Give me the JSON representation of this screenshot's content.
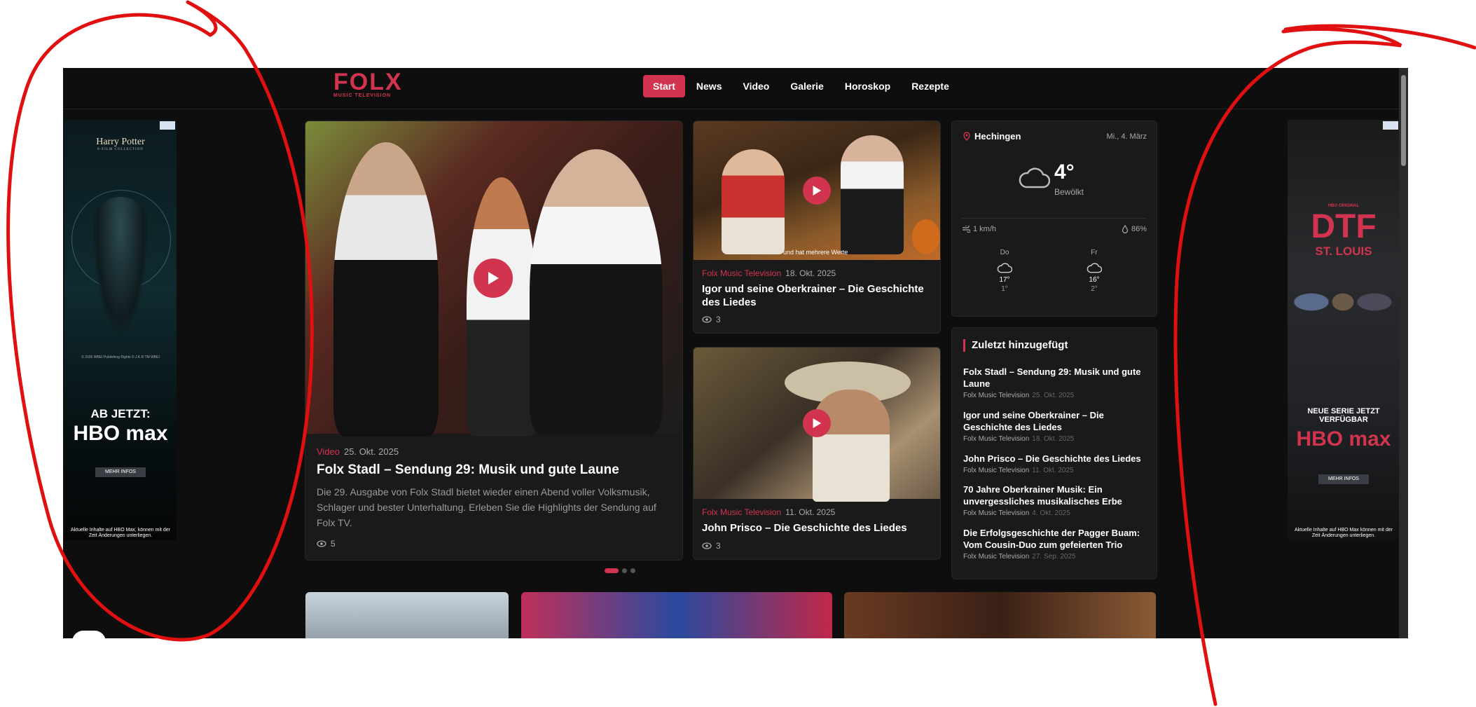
{
  "site": {
    "logo_text": "FOLX",
    "logo_subtitle": "MUSIC TELEVISION"
  },
  "nav": [
    {
      "label": "Start",
      "active": true
    },
    {
      "label": "News",
      "active": false
    },
    {
      "label": "Video",
      "active": false
    },
    {
      "label": "Galerie",
      "active": false
    },
    {
      "label": "Horoskop",
      "active": false
    },
    {
      "label": "Rezepte",
      "active": false
    }
  ],
  "ad_left": {
    "brand": "Harry Potter",
    "brand_sub": "8-FILM COLLECTION",
    "copyright": "© 2026 WBEI Publishing Rights © J.K.R TM WBEI",
    "cta": "AB JETZT:",
    "logo": "HBO max",
    "button": "MEHR INFOS",
    "fine_print": "Aktuelle Inhalte auf HBO Max, können mit der Zeit Änderungen unterliegen."
  },
  "ad_right": {
    "brand": "HBO ORIGINAL",
    "title": "DTF",
    "subtitle": "ST. LOUIS",
    "cta": "NEUE SERIE JETZT VERFÜGBAR",
    "logo": "HBO max",
    "button": "MEHR INFOS",
    "fine_print": "Aktuelle Inhalte auf HBO Max können mit der Zeit Änderungen unterliegen."
  },
  "hero": {
    "category": "Video",
    "date": "25. Okt. 2025",
    "title": "Folx Stadl – Sendung 29: Musik und gute Laune",
    "description": "Die 29. Ausgabe von Folx Stadl bietet wieder einen Abend voller Volksmusik, Schlager und bester Unterhaltung. Erleben Sie die Highlights der Sendung auf Folx TV.",
    "views": "5"
  },
  "cards": [
    {
      "category": "Folx Music Television",
      "date": "18. Okt. 2025",
      "title": "Igor und seine Oberkrainer – Die Geschichte des Liedes",
      "views": "3",
      "image_caption": "und hat mehrere Werte"
    },
    {
      "category": "Folx Music Television",
      "date": "11. Okt. 2025",
      "title": "John Prisco – Die Geschichte des Liedes",
      "views": "3"
    }
  ],
  "weather": {
    "city": "Hechingen",
    "date": "Mi., 4. März",
    "temp": "4°",
    "condition": "Bewölkt",
    "wind": "1 km/h",
    "humidity": "86%",
    "forecast": [
      {
        "day": "Do",
        "hi": "17°",
        "lo": "1°"
      },
      {
        "day": "Fr",
        "hi": "16°",
        "lo": "2°"
      }
    ]
  },
  "recent": {
    "heading": "Zuletzt hinzugefügt",
    "items": [
      {
        "title": "Folx Stadl – Sendung 29: Musik und gute Laune",
        "source": "Folx Music Television",
        "date": "25. Okt. 2025"
      },
      {
        "title": "Igor und seine Oberkrainer – Die Geschichte des Liedes",
        "source": "Folx Music Television",
        "date": "18. Okt. 2025"
      },
      {
        "title": "John Prisco – Die Geschichte des Liedes",
        "source": "Folx Music Television",
        "date": "11. Okt. 2025"
      },
      {
        "title": "70 Jahre Oberkrainer Musik: Ein unvergessliches musikalisches Erbe",
        "source": "Folx Music Television",
        "date": "4. Okt. 2025"
      },
      {
        "title": "Die Erfolgsgeschichte der Pagger Buam: Vom Cousin-Duo zum gefeierten Trio",
        "source": "Folx Music Television",
        "date": "27. Sep. 2025"
      }
    ]
  },
  "colors": {
    "accent": "#d2344f",
    "background": "#0e0e0e",
    "card": "#1a1a1a",
    "annotation": "#e01010"
  },
  "icons": [
    "play-icon",
    "eye-icon",
    "location-pin-icon",
    "cloud-icon",
    "wind-icon",
    "humidity-icon",
    "adchoices-icon"
  ]
}
